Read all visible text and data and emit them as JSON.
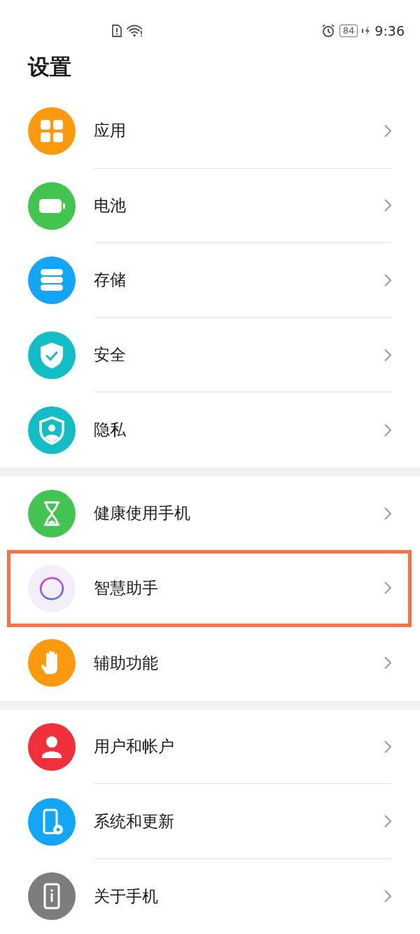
{
  "status_bar": {
    "battery": "84",
    "time": "9:36"
  },
  "title": "设置",
  "groups": [
    {
      "items": [
        {
          "label": "应用",
          "kind": "apps",
          "color": "#fb9a0e",
          "highlighted": false
        },
        {
          "label": "电池",
          "kind": "battery",
          "color": "#43c34f",
          "highlighted": false
        },
        {
          "label": "存储",
          "kind": "storage",
          "color": "#14a6f6",
          "highlighted": false
        },
        {
          "label": "安全",
          "kind": "security",
          "color": "#12bdc6",
          "highlighted": false
        },
        {
          "label": "隐私",
          "kind": "privacy",
          "color": "#12bdc6",
          "highlighted": false
        }
      ]
    },
    {
      "items": [
        {
          "label": "健康使用手机",
          "kind": "wellbeing",
          "color": "#43c34f",
          "highlighted": false
        },
        {
          "label": "智慧助手",
          "kind": "assistant",
          "color": "#f3eef7",
          "highlighted": true
        },
        {
          "label": "辅助功能",
          "kind": "accessibility",
          "color": "#fb9a0e",
          "highlighted": false
        }
      ]
    },
    {
      "items": [
        {
          "label": "用户和帐户",
          "kind": "user",
          "color": "#f0303a",
          "highlighted": false
        },
        {
          "label": "系统和更新",
          "kind": "update",
          "color": "#14a6f6",
          "highlighted": false
        },
        {
          "label": "关于手机",
          "kind": "about",
          "color": "#7d7d7d",
          "highlighted": false
        }
      ]
    }
  ]
}
